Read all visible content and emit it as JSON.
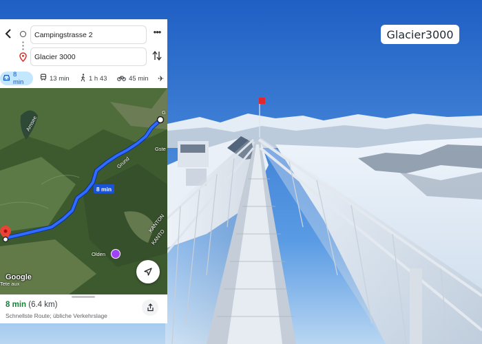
{
  "brand": {
    "label": "Glacier3000"
  },
  "directions": {
    "origin": "Campingstrasse 2",
    "destination": "Glacier 3000",
    "back_icon": "arrow-back-icon",
    "more_icon": "more-horizontal-icon",
    "swap_icon": "swap-vertical-icon"
  },
  "modes": [
    {
      "name": "drive",
      "icon": "car-icon",
      "label": "8 min",
      "active": true
    },
    {
      "name": "transit",
      "icon": "train-icon",
      "label": "13 min",
      "active": false
    },
    {
      "name": "walk",
      "icon": "walk-icon",
      "label": "1 h 43",
      "active": false
    },
    {
      "name": "bike",
      "icon": "bike-icon",
      "label": "45 min",
      "active": false
    },
    {
      "name": "flight",
      "icon": "plane-icon",
      "label": "",
      "active": false
    }
  ],
  "map": {
    "route_label": "8 min",
    "logo": "Google",
    "labels": {
      "arnsee": "Arnsee",
      "grund": "Grund",
      "olden": "Olden",
      "kanton1": "KANTON",
      "kanton2": "KANTO",
      "gste": "Gste",
      "g": "G",
      "tete": "Tete aux"
    }
  },
  "route_summary": {
    "time": "8 min",
    "distance": "(6.4 km)",
    "description": "Schnellste Route; übliche Verkehrslage"
  },
  "colors": {
    "route": "#1a53d6",
    "active_mode_bg": "#c2e7ff",
    "time_green": "#188038",
    "sky": "#2f74c8"
  }
}
